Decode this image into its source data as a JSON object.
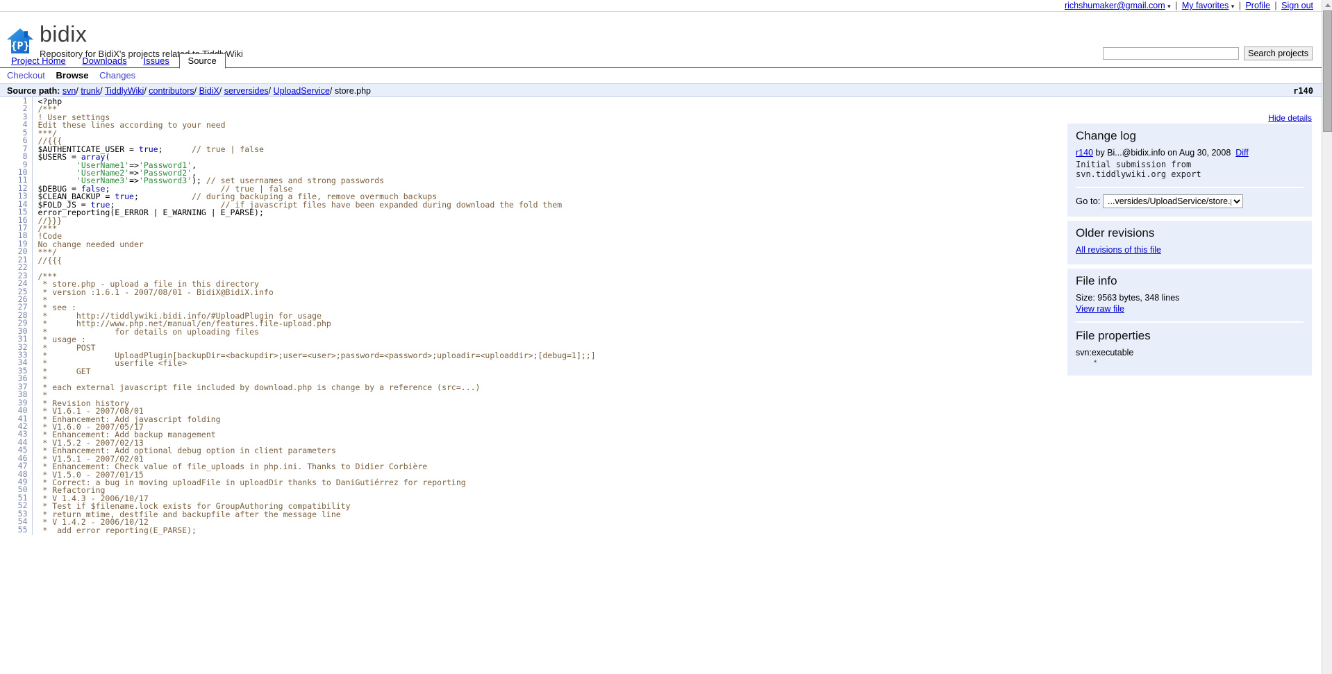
{
  "userbar": {
    "account": "richshumaker@gmail.com",
    "favorites": "My favorites",
    "profile": "Profile",
    "signout": "Sign out",
    "separator": "|",
    "caret": "▾"
  },
  "masthead": {
    "project_name": "bidix",
    "tagline": "Repository for BidiX's projects related to TiddlyWiki",
    "logo_glyph": "{P}"
  },
  "search": {
    "value": "",
    "placeholder": "",
    "button_label": "Search projects"
  },
  "tabs": [
    {
      "label": "Project Home",
      "selected": false
    },
    {
      "label": "Downloads",
      "selected": false
    },
    {
      "label": "Issues",
      "selected": false
    },
    {
      "label": "Source",
      "selected": true
    }
  ],
  "subtabs": [
    {
      "label": "Checkout",
      "current": false
    },
    {
      "label": "Browse",
      "current": true
    },
    {
      "label": "Changes",
      "current": false
    }
  ],
  "pathbar": {
    "label": "Source path:",
    "crumbs": [
      "svn",
      "trunk",
      "TiddlyWiki",
      "contributors",
      "BidiX",
      "serversides",
      "UploadService"
    ],
    "file": "store.php",
    "revision": "r140"
  },
  "hide_details": "Hide details",
  "changelog": {
    "heading": "Change log",
    "revision": "r140",
    "by_text": "by Bi...@bidix.info on Aug 30, 2008",
    "diff": "Diff",
    "message": "Initial submission from svn.tiddlywiki.org export",
    "goto_label": "Go to:",
    "goto_value": "...versides/UploadService/store.php"
  },
  "older_revisions": {
    "heading": "Older revisions",
    "link": "All revisions of this file"
  },
  "file_info": {
    "heading": "File info",
    "size_text": "Size: 9563 bytes, 348 lines",
    "raw_link": "View raw file"
  },
  "file_properties": {
    "heading": "File properties",
    "prop_name": "svn:executable",
    "prop_value": "*"
  },
  "code": {
    "first_line": 1,
    "lines": [
      "<?php",
      "/***",
      "! User settings",
      "Edit these lines according to your need",
      "***/",
      "//{{{",
      "$AUTHENTICATE_USER = true;      // true | false",
      "$USERS = array(",
      "        'UserName1'=>'Password1',",
      "        'UserName2'=>'Password2',",
      "        'UserName3'=>'Password3'); // set usernames and strong passwords",
      "$DEBUG = false;                       // true | false",
      "$CLEAN_BACKUP = true;           // during backuping a file, remove overmuch backups",
      "$FOLD_JS = true;                      // if javascript files have been expanded during download the fold them",
      "error_reporting(E_ERROR | E_WARNING | E_PARSE);",
      "//}}}",
      "/***",
      "!Code",
      "No change needed under",
      "***/",
      "//{{{",
      "",
      "/***",
      " * store.php - upload a file in this directory",
      " * version :1.6.1 - 2007/08/01 - BidiX@BidiX.info",
      " *",
      " * see :",
      " *      http://tiddlywiki.bidi.info/#UploadPlugin for usage",
      " *      http://www.php.net/manual/en/features.file-upload.php",
      " *              for details on uploading files",
      " * usage :",
      " *      POST",
      " *              UploadPlugin[backupDir=<backupdir>;user=<user>;password=<password>;uploadir=<uploaddir>;[debug=1];;]",
      " *              userfile <file>",
      " *      GET",
      " *",
      " * each external javascript file included by download.php is change by a reference (src=...)",
      " *",
      " * Revision history",
      " * V1.6.1 - 2007/08/01",
      " * Enhancement: Add javascript folding",
      " * V1.6.0 - 2007/05/17",
      " * Enhancement: Add backup management",
      " * V1.5.2 - 2007/02/13",
      " * Enhancement: Add optional debug option in client parameters",
      " * V1.5.1 - 2007/02/01",
      " * Enhancement: Check value of file_uploads in php.ini. Thanks to Didier Corbière",
      " * V1.5.0 - 2007/01/15",
      " * Correct: a bug in moving uploadFile in uploadDir thanks to DaniGutiérrez for reporting",
      " * Refactoring",
      " * V 1.4.3 - 2006/10/17",
      " * Test if $filename.lock exists for GroupAuthoring compatibility",
      " * return mtime, destfile and backupfile after the message line",
      " * V 1.4.2 - 2006/10/12",
      " *  add error reporting(E_PARSE);"
    ]
  },
  "colors": {
    "accent_blue": "#3a5bc5",
    "link_blue": "#0000cc",
    "panel_bg": "#e8eefa",
    "comment": "#7a5f3f",
    "string": "#2e8b3f",
    "keyword": "#0000aa",
    "lineno": "#7a85b0"
  }
}
